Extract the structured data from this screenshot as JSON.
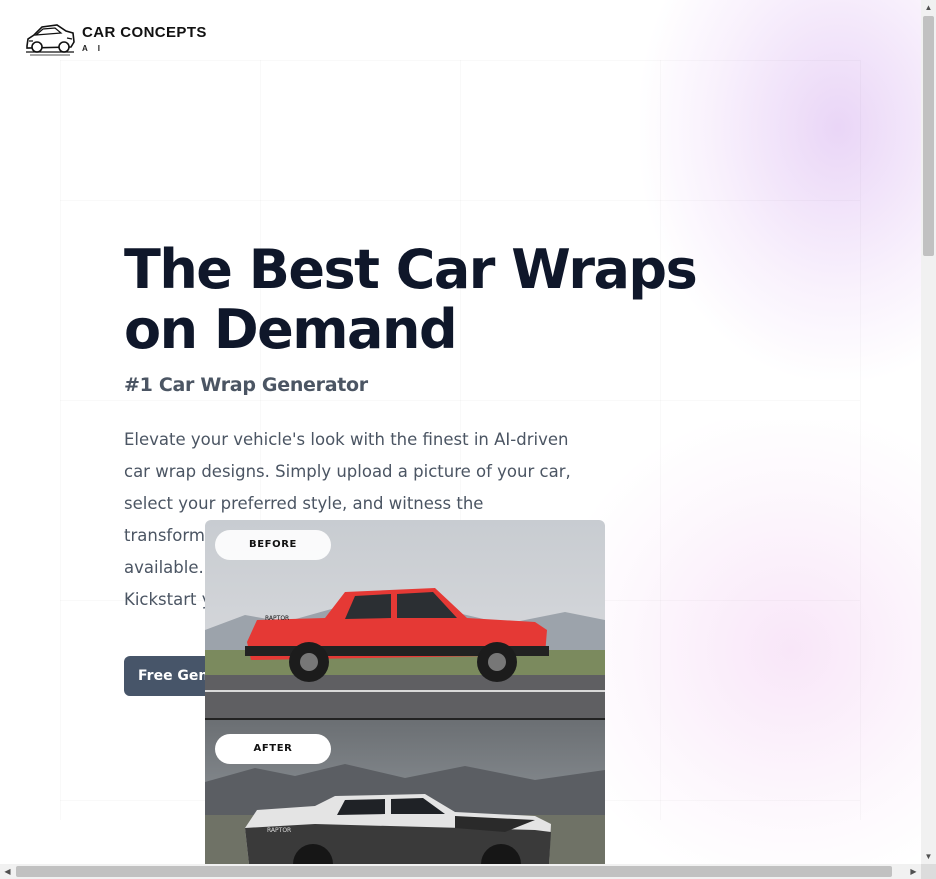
{
  "brand": {
    "name": "CAR CONCEPTS",
    "sub": "A I",
    "logo_icon": "car-outline-icon"
  },
  "hero": {
    "title_line1": "The Best Car Wraps",
    "title_line2": "on Demand",
    "subtitle": "#1 Car Wrap Generator",
    "description": "Elevate your vehicle's look with the finest in AI-driven car wrap designs. Simply upload a picture of your car, select your preferred style, and witness the transformation with one of the best car wraps available. Dive into extraordinary from ordinary. Kickstart your car's design revamp now!",
    "cta_label": "Free Gene"
  },
  "comparison": {
    "before_label": "BEFORE",
    "after_label": "AFTER",
    "before_car_badge": "RAPTOR",
    "after_car_badge": "RAPTOR"
  },
  "colors": {
    "heading": "#0f172a",
    "body_text": "#4b5563",
    "cta_bg": "#475569",
    "accent_glow": "#d8b4f0"
  },
  "scrollbars": {
    "up_arrow": "▲",
    "down_arrow": "▼",
    "left_arrow": "◀",
    "right_arrow": "▶"
  }
}
